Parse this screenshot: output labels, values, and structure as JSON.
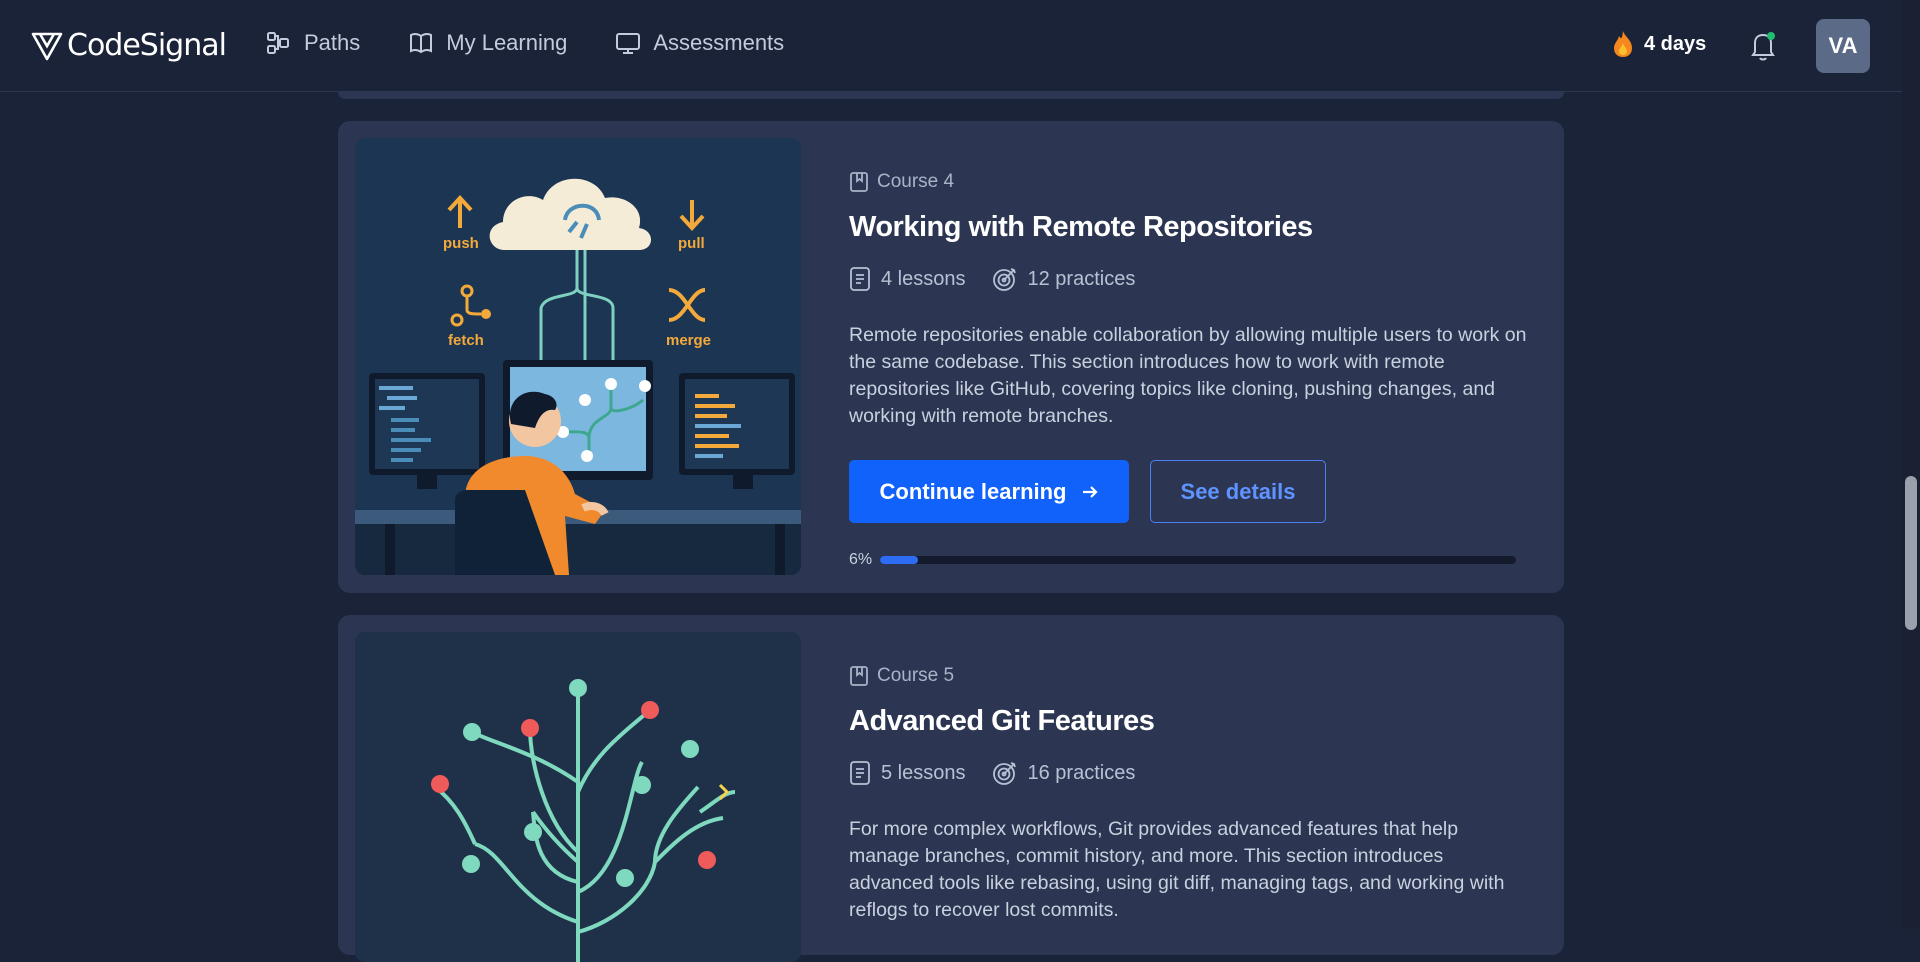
{
  "brand": {
    "name": "CodeSignal"
  },
  "nav": [
    {
      "label": "Paths",
      "icon": "paths-icon"
    },
    {
      "label": "My Learning",
      "icon": "book-icon"
    },
    {
      "label": "Assessments",
      "icon": "monitor-icon"
    }
  ],
  "header": {
    "streak": "4 days",
    "avatar_initials": "VA"
  },
  "courses": [
    {
      "label": "Course 4",
      "title": "Working with Remote Repositories",
      "lessons": "4 lessons",
      "practices": "12 practices",
      "description": "Remote repositories enable collaboration by allowing multiple users to work on the same codebase. This section introduces how to work with remote repositories like GitHub, covering topics like cloning, pushing changes, and working with remote branches.",
      "primary_button": "Continue learning",
      "secondary_button": "See details",
      "progress_label": "6%",
      "progress_value": 0.06,
      "illustration_labels": {
        "push": "push",
        "pull": "pull",
        "fetch": "fetch",
        "merge": "merge"
      }
    },
    {
      "label": "Course 5",
      "title": "Advanced Git Features",
      "lessons": "5 lessons",
      "practices": "16 practices",
      "description": "For more complex workflows, Git provides advanced features that help manage branches, commit history, and more. This section introduces advanced tools like rebasing, using git diff, managing tags, and working with reflogs to recover lost commits."
    }
  ],
  "colors": {
    "background": "#1b2338",
    "card": "#2c3652",
    "primary": "#1062fb",
    "accent_orange": "#f4a93b"
  }
}
